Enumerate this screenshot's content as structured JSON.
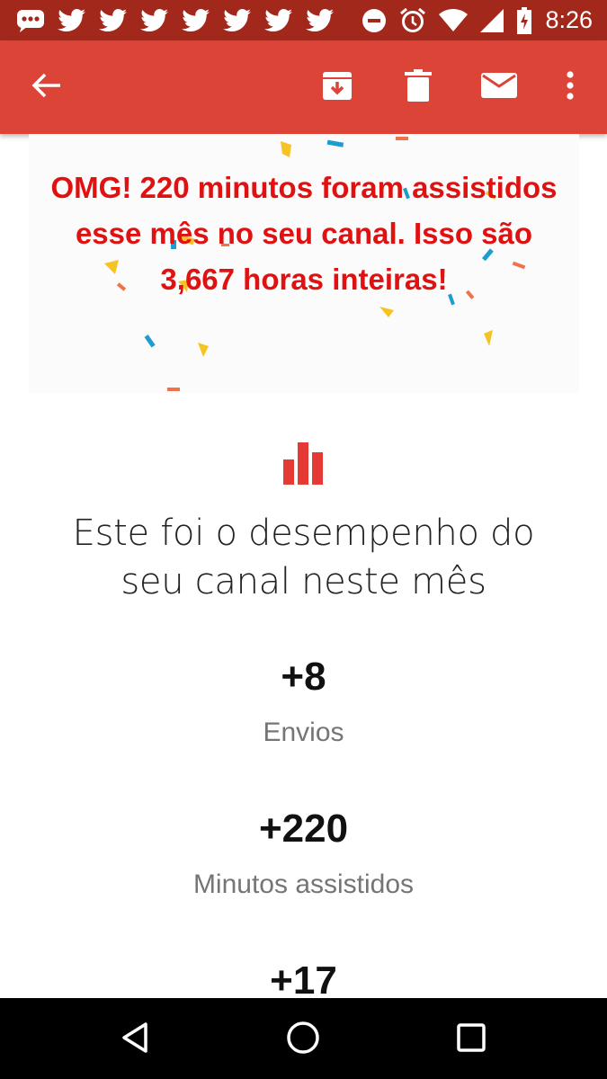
{
  "status_bar": {
    "time": "8:26",
    "notification_icons": [
      "messaging-icon",
      "twitter-icon",
      "twitter-icon",
      "twitter-icon",
      "twitter-icon",
      "twitter-icon",
      "twitter-icon",
      "twitter-icon"
    ],
    "system_icons": [
      "do-not-disturb-icon",
      "alarm-icon",
      "wifi-icon",
      "cell-signal-icon",
      "battery-charging-icon"
    ],
    "background_color": "#a3281c"
  },
  "app_bar": {
    "background_color": "#db4437",
    "actions": [
      "back-icon",
      "archive-icon",
      "delete-icon",
      "mark-unread-icon",
      "more-options-icon"
    ]
  },
  "banner": {
    "lines": [
      "OMG! 220 minutos foram assistidos",
      "esse mês no seu canal. Isso são",
      "3,667 horas inteiras!"
    ],
    "text_color": "#e01111"
  },
  "performance": {
    "icon": "bar-chart-icon",
    "icon_color": "#e53935",
    "headline_lines": [
      "Este foi o desempenho do",
      "seu canal neste mês"
    ],
    "metrics": [
      {
        "value": "+8",
        "label": "Envios"
      },
      {
        "value": "+220",
        "label": "Minutos assistidos"
      },
      {
        "value": "+17",
        "label": ""
      }
    ]
  },
  "nav_bar": {
    "buttons": [
      "back-triangle-icon",
      "home-circle-icon",
      "recents-square-icon"
    ]
  }
}
